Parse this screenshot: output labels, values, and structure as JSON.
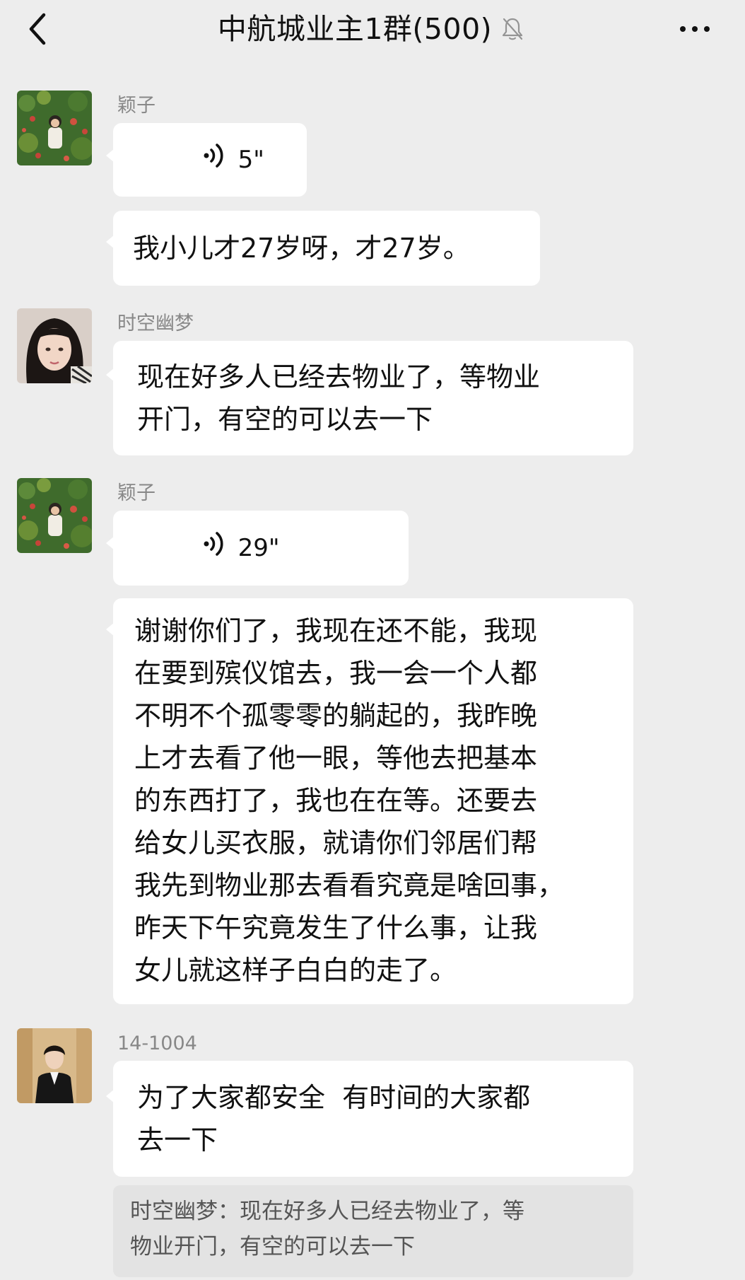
{
  "header": {
    "title": "中航城业主1群(500)",
    "back_icon": "back-chevron-icon",
    "mute_icon": "bell-muted-icon",
    "more_icon": "more-dots-icon"
  },
  "messages": [
    {
      "sender": "颖子",
      "avatar": "garden-photo-avatar",
      "voice_duration": "5\"",
      "text": "我小儿才27岁呀，才27岁。"
    },
    {
      "sender": "时空幽梦",
      "avatar": "woman-portrait-avatar",
      "text": "现在好多人已经去物业了，等物业\n开门，有空的可以去一下"
    },
    {
      "sender": "颖子",
      "avatar": "garden-photo-avatar",
      "voice_duration": "29\"",
      "text": "谢谢你们了，我现在还不能，我现\n在要到殡仪馆去，我一会一个人都\n不明不个孤零零的躺起的，我昨晚\n上才去看了他一眼，等他去把基本\n的东西打了，我也在在等。还要去\n给女儿买衣服，就请你们邻居们帮\n我先到物业那去看看究竟是啥回事，\n昨天下午究竟发生了什么事，让我\n女儿就这样子白白的走了。"
    },
    {
      "sender": "14-1004",
      "avatar": "man-portrait-avatar",
      "text": "为了大家都安全  有时间的大家都\n去一下",
      "quote": "时空幽梦：现在好多人已经去物业了，等\n物业开门，有空的可以去一下"
    }
  ]
}
